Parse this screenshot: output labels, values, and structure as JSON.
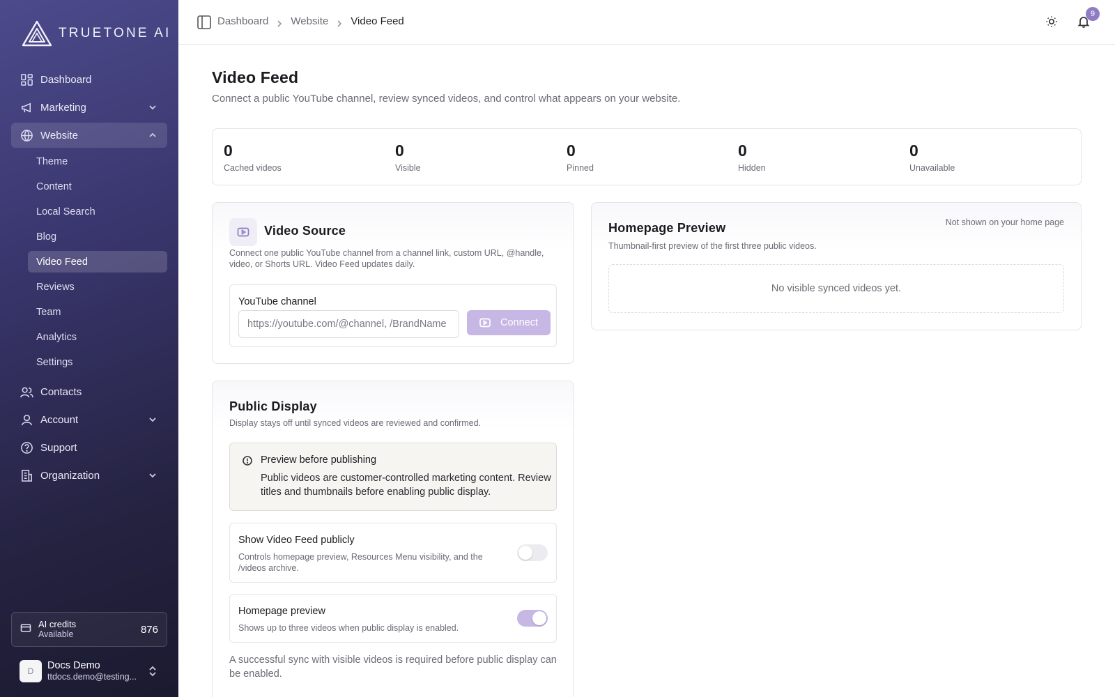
{
  "brand": {
    "name": "TRUETONE AI"
  },
  "sidebar": {
    "items": [
      {
        "label": "Dashboard",
        "icon": "dashboard-icon"
      },
      {
        "label": "Marketing",
        "icon": "megaphone-icon"
      },
      {
        "label": "Website",
        "icon": "globe-icon"
      },
      {
        "label": "Contacts",
        "icon": "users-icon"
      },
      {
        "label": "Account",
        "icon": "user-icon"
      },
      {
        "label": "Support",
        "icon": "help-circle-icon"
      },
      {
        "label": "Organization",
        "icon": "building-icon"
      }
    ],
    "website_sub": [
      "Theme",
      "Content",
      "Local Search",
      "Blog",
      "Video Feed",
      "Reviews",
      "Team",
      "Analytics",
      "Settings"
    ],
    "credits": {
      "title": "AI credits",
      "subtitle": "Available",
      "value": "876"
    },
    "user": {
      "initial": "D",
      "name": "Docs Demo",
      "email": "ttdocs.demo@testing..."
    }
  },
  "topbar": {
    "breadcrumb": [
      "Dashboard",
      "Website",
      "Video Feed"
    ],
    "notification_count": "9"
  },
  "page": {
    "title": "Video Feed",
    "subtitle": "Connect a public YouTube channel, review synced videos, and control what appears on your website."
  },
  "stats": [
    {
      "value": "0",
      "label": "Cached videos"
    },
    {
      "value": "0",
      "label": "Visible"
    },
    {
      "value": "0",
      "label": "Pinned"
    },
    {
      "value": "0",
      "label": "Hidden"
    },
    {
      "value": "0",
      "label": "Unavailable"
    }
  ],
  "video_source": {
    "title": "Video Source",
    "description": "Connect one public YouTube channel from a channel link, custom URL, @handle, video, or Shorts URL. Video Feed updates daily.",
    "field_label": "YouTube channel",
    "placeholder": "https://youtube.com/@channel, /BrandName",
    "connect_label": "Connect"
  },
  "homepage_preview": {
    "title": "Homepage Preview",
    "description": "Thumbnail-first preview of the first three public videos.",
    "status": "Not shown on your home page",
    "empty": "No visible synced videos yet."
  },
  "public_display": {
    "title": "Public Display",
    "description": "Display stays off until synced videos are reviewed and confirmed.",
    "alert_title": "Preview before publishing",
    "alert_body": "Public videos are customer-controlled marketing content. Review titles and thumbnails before enabling public display.",
    "toggles": [
      {
        "title": "Show Video Feed publicly",
        "description": "Controls homepage preview, Resources Menu visibility, and the /videos archive.",
        "enabled": false
      },
      {
        "title": "Homepage preview",
        "description": "Shows up to three videos when public display is enabled.",
        "enabled": true
      }
    ],
    "footnote": "A successful sync with visible videos is required before public display can be enabled."
  },
  "colors": {
    "accent": "#c6b7e4",
    "badge": "#8f7cc4",
    "sidebar_top": "#4d4a8c",
    "sidebar_bottom": "#1b1a30"
  }
}
